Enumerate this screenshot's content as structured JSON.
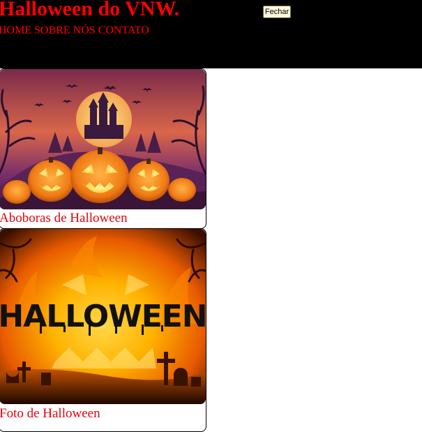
{
  "header": {
    "title": "Halloween do VNW.",
    "nav": [
      "HOME",
      "SOBRE NÓS",
      "CONTATO"
    ],
    "close_button": "Fechar"
  },
  "cards": [
    {
      "caption": "Aboboras de Halloween",
      "image": "jack-o-lanterns-haunted-castle"
    },
    {
      "caption": "Foto de Halloween",
      "image": "halloween-fire-graveyard",
      "image_text": "HALLOWEEN"
    }
  ],
  "colors": {
    "header_bg": "#000000",
    "accent": "#ff0000",
    "button_bg": "#fff8dc"
  }
}
